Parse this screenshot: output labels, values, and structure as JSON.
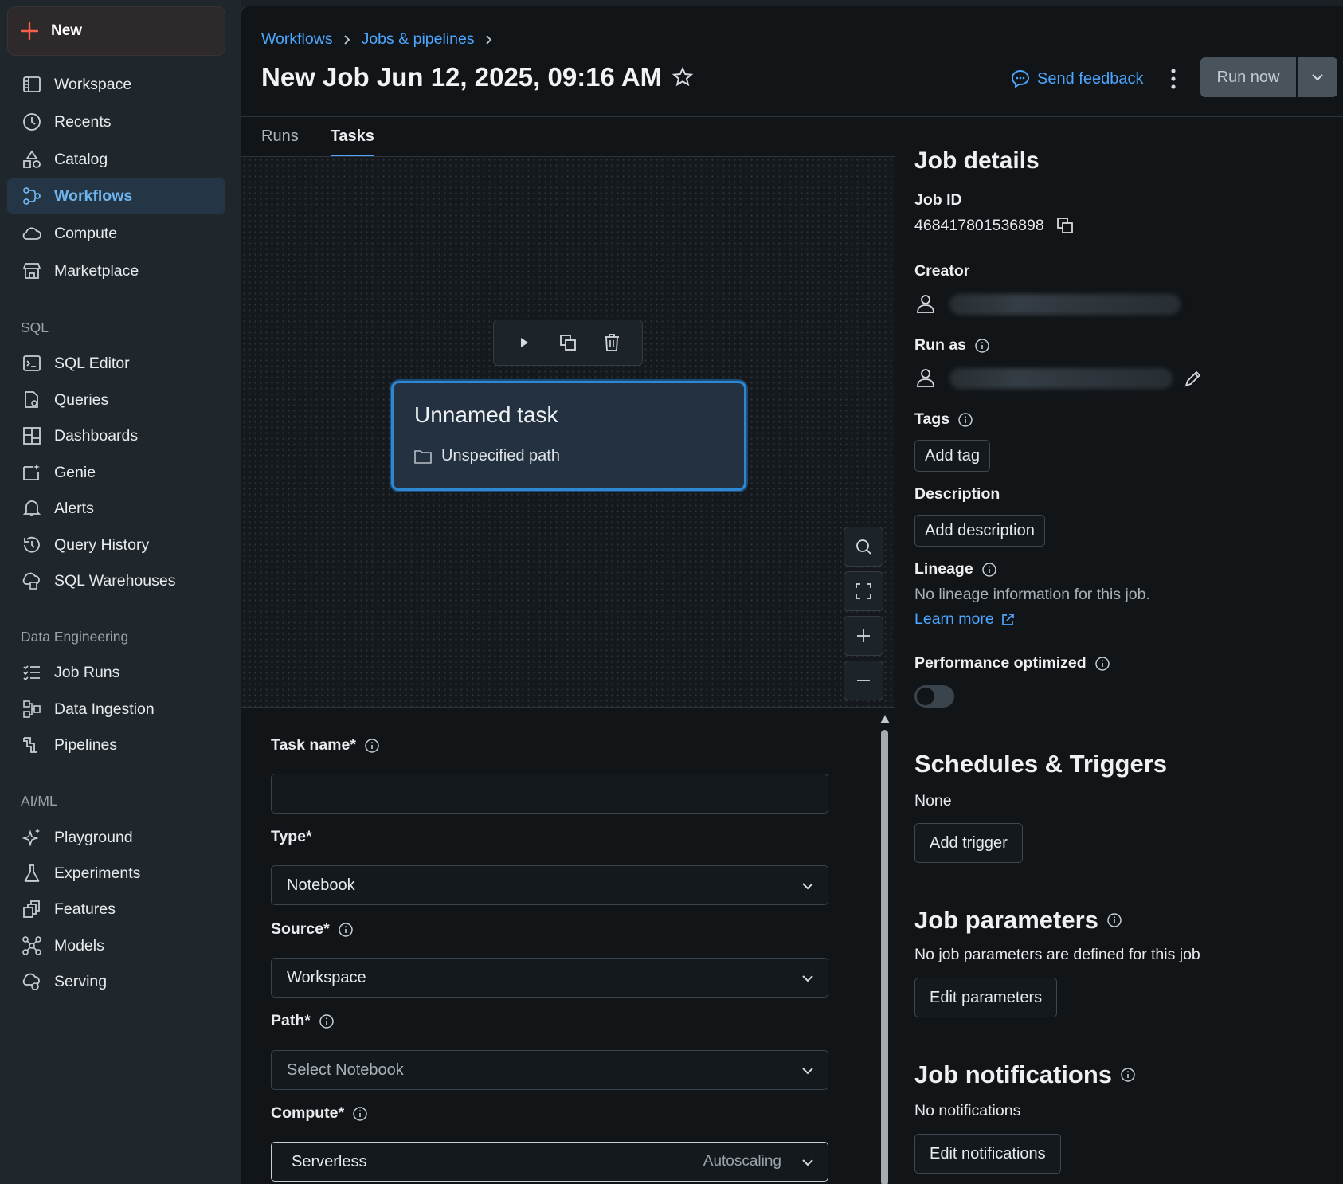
{
  "sidebar": {
    "new_label": "New",
    "items": [
      {
        "label": "Workspace",
        "icon": "workspace-icon"
      },
      {
        "label": "Recents",
        "icon": "clock-icon"
      },
      {
        "label": "Catalog",
        "icon": "catalog-icon"
      },
      {
        "label": "Workflows",
        "icon": "workflows-icon",
        "active": true
      },
      {
        "label": "Compute",
        "icon": "cloud-icon"
      },
      {
        "label": "Marketplace",
        "icon": "store-icon"
      }
    ],
    "sql_section": "SQL",
    "sql_items": [
      {
        "label": "SQL Editor",
        "icon": "sql-editor-icon"
      },
      {
        "label": "Queries",
        "icon": "queries-icon"
      },
      {
        "label": "Dashboards",
        "icon": "dashboard-icon"
      },
      {
        "label": "Genie",
        "icon": "genie-icon"
      },
      {
        "label": "Alerts",
        "icon": "bell-icon"
      },
      {
        "label": "Query History",
        "icon": "history-icon"
      },
      {
        "label": "SQL Warehouses",
        "icon": "warehouse-icon"
      }
    ],
    "de_section": "Data Engineering",
    "de_items": [
      {
        "label": "Job Runs",
        "icon": "job-runs-icon"
      },
      {
        "label": "Data Ingestion",
        "icon": "ingestion-icon"
      },
      {
        "label": "Pipelines",
        "icon": "pipelines-icon"
      }
    ],
    "ai_section": "AI/ML",
    "ai_items": [
      {
        "label": "Playground",
        "icon": "sparkle-icon"
      },
      {
        "label": "Experiments",
        "icon": "flask-icon"
      },
      {
        "label": "Features",
        "icon": "features-icon"
      },
      {
        "label": "Models",
        "icon": "models-icon"
      },
      {
        "label": "Serving",
        "icon": "serving-icon"
      }
    ]
  },
  "header": {
    "breadcrumb": [
      "Workflows",
      "Jobs & pipelines"
    ],
    "title": "New Job Jun 12, 2025, 09:16 AM",
    "feedback_label": "Send feedback",
    "run_now_label": "Run now"
  },
  "tabs": [
    {
      "label": "Runs",
      "active": false
    },
    {
      "label": "Tasks",
      "active": true
    }
  ],
  "canvas": {
    "task_title": "Unnamed task",
    "task_path": "Unspecified path"
  },
  "form": {
    "task_name_label": "Task name*",
    "task_name_value": "",
    "type_label": "Type*",
    "type_value": "Notebook",
    "source_label": "Source*",
    "source_value": "Workspace",
    "path_label": "Path*",
    "path_placeholder": "Select Notebook",
    "compute_label": "Compute*",
    "compute_value": "Serverless",
    "compute_hint": "Autoscaling"
  },
  "details": {
    "heading": "Job details",
    "job_id_label": "Job ID",
    "job_id": "468417801536898",
    "creator_label": "Creator",
    "run_as_label": "Run as",
    "tags_label": "Tags",
    "add_tag": "Add tag",
    "description_label": "Description",
    "add_description": "Add description",
    "lineage_label": "Lineage",
    "lineage_text": "No lineage information for this job.",
    "learn_more": "Learn more",
    "perf_label": "Performance optimized",
    "perf_enabled": false,
    "schedules_heading": "Schedules & Triggers",
    "schedules_value": "None",
    "add_trigger": "Add trigger",
    "params_heading": "Job parameters",
    "params_text": "No job parameters are defined for this job",
    "edit_params": "Edit parameters",
    "notif_heading": "Job notifications",
    "notif_text": "No notifications",
    "edit_notif": "Edit notifications"
  },
  "colors": {
    "accent": "#4da6ff",
    "new_plus": "#ff5f46",
    "node_border": "#2f86d1"
  }
}
